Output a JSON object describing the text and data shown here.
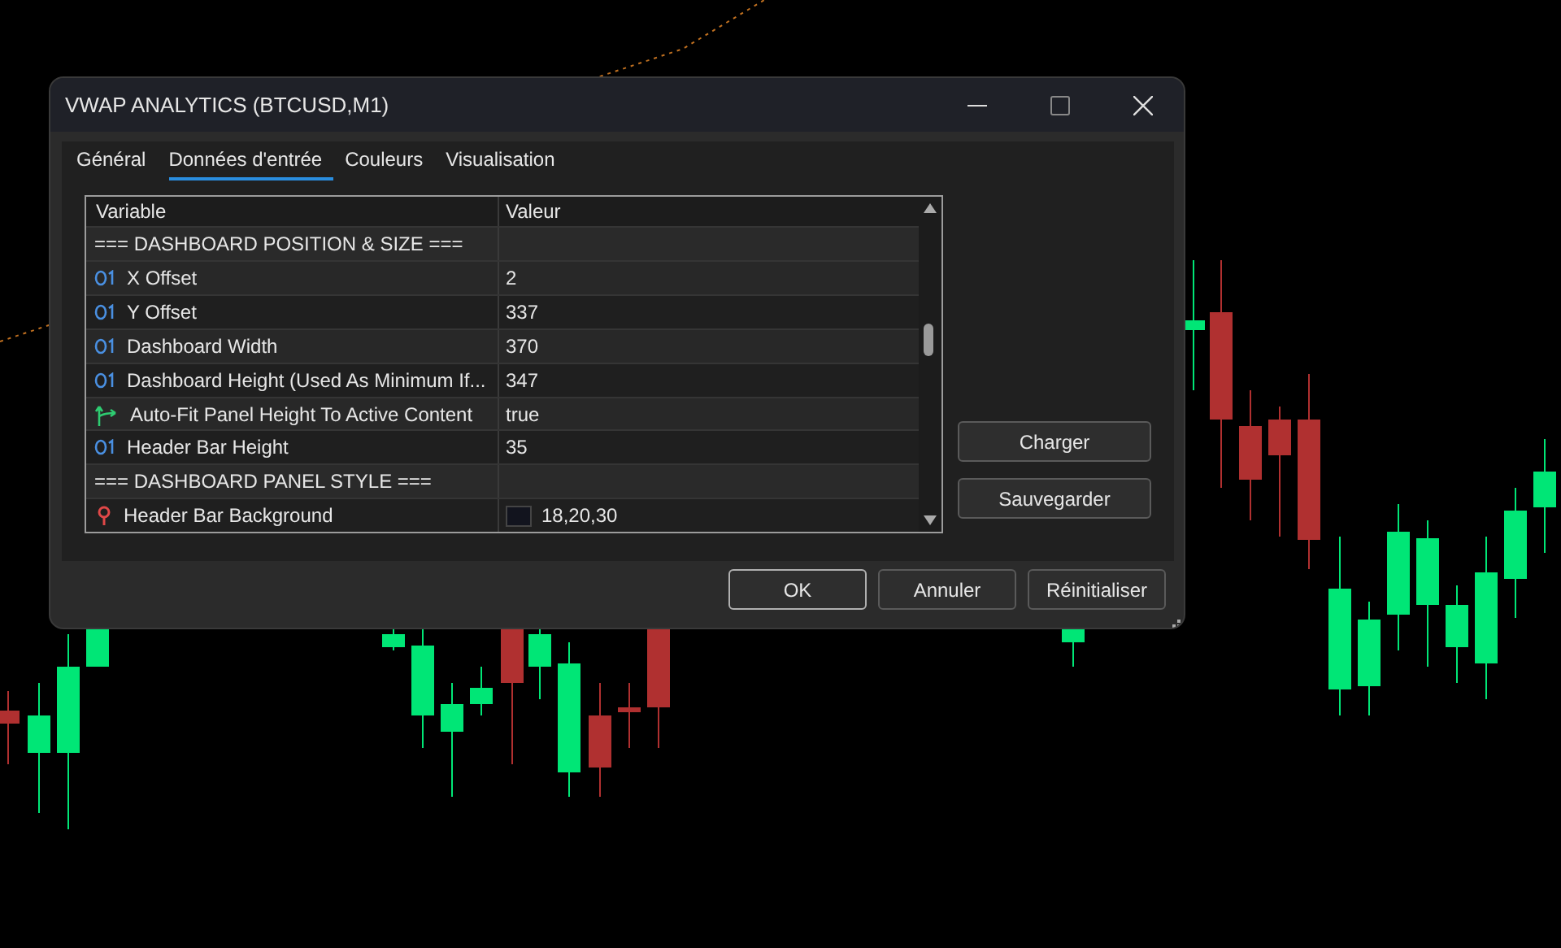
{
  "window": {
    "title": "VWAP ANALYTICS (BTCUSD,M1)"
  },
  "tabs": [
    {
      "label": "Général",
      "selected": false
    },
    {
      "label": "Données d'entrée",
      "selected": true
    },
    {
      "label": "Couleurs",
      "selected": false
    },
    {
      "label": "Visualisation",
      "selected": false
    }
  ],
  "table": {
    "columns": [
      "Variable",
      "Valeur"
    ],
    "rows": [
      {
        "kind": "section",
        "variable": "=== DASHBOARD POSITION & SIZE ==="
      },
      {
        "kind": "int",
        "variable": "X Offset",
        "value": "2"
      },
      {
        "kind": "int",
        "variable": "Y Offset",
        "value": "337"
      },
      {
        "kind": "int",
        "variable": "Dashboard Width",
        "value": "370"
      },
      {
        "kind": "int",
        "variable": "Dashboard Height (Used As Minimum If...",
        "value": "347"
      },
      {
        "kind": "bool",
        "variable": "Auto-Fit Panel Height To Active Content",
        "value": "true"
      },
      {
        "kind": "int",
        "variable": "Header Bar Height",
        "value": "35"
      },
      {
        "kind": "section",
        "variable": "=== DASHBOARD PANEL STYLE ==="
      },
      {
        "kind": "color",
        "variable": "Header Bar Background",
        "value": "18,20,30",
        "color": "#12141e"
      }
    ]
  },
  "side_buttons": [
    "Charger",
    "Sauvegarder"
  ],
  "buttons": [
    {
      "label": "OK",
      "default": true
    },
    {
      "label": "Annuler",
      "default": false
    },
    {
      "label": "Réinitialiser",
      "default": false
    }
  ]
}
